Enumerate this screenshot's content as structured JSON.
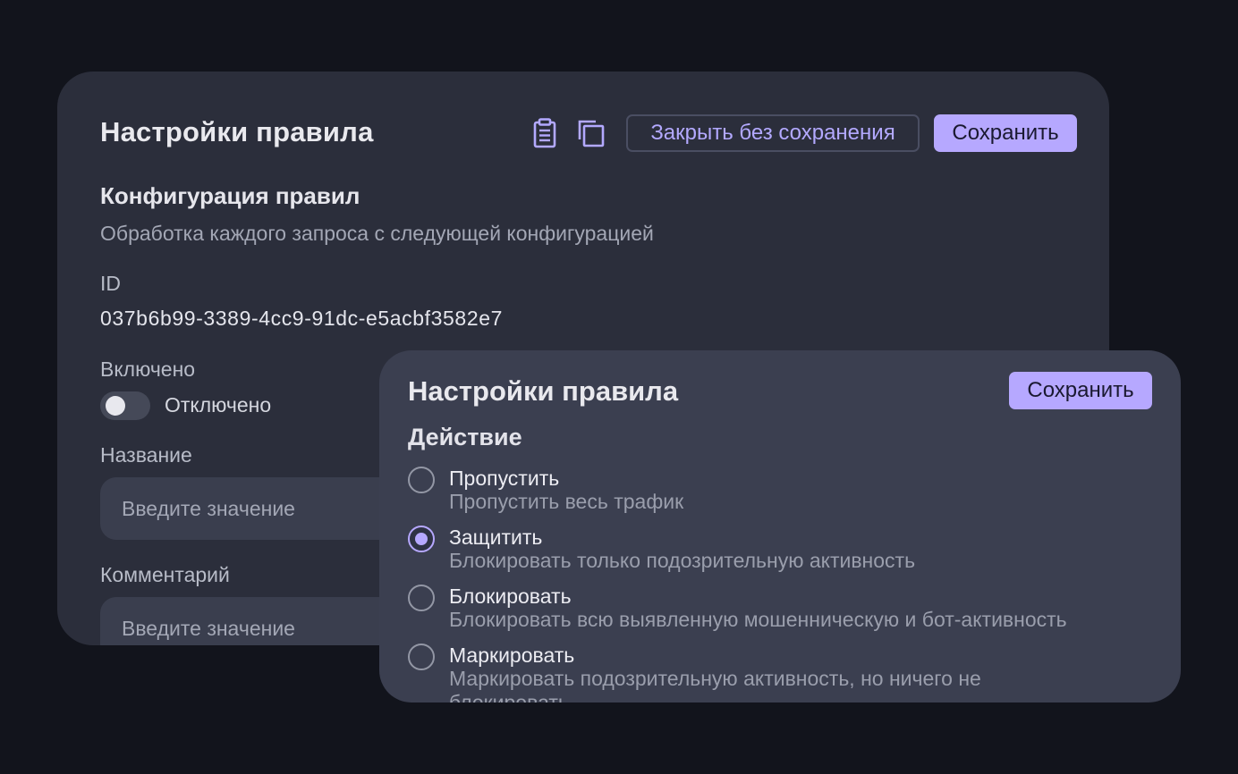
{
  "back_panel": {
    "title": "Настройки правила",
    "icons": [
      "clipboard-icon",
      "copy-icon"
    ],
    "close_button": "Закрыть без сохранения",
    "save_button": "Сохранить",
    "section_title": "Конфигурация правил",
    "section_subtitle": "Обработка каждого запроса с следующей конфигурацией",
    "id_label": "ID",
    "id_value": "037b6b99-3389-4cc9-91dc-e5acbf3582e7",
    "enabled_label": "Включено",
    "toggle_state_text": "Отключено",
    "toggle_on": false,
    "name_label": "Название",
    "name_placeholder": "Введите значение",
    "comment_label": "Комментарий",
    "comment_placeholder": "Введите значение"
  },
  "front_panel": {
    "title": "Настройки правила",
    "save_button": "Сохранить",
    "action_title": "Действие",
    "options": [
      {
        "label": "Пропустить",
        "description": "Пропустить весь трафик",
        "selected": false
      },
      {
        "label": "Защитить",
        "description": "Блокировать только подозрительную активность",
        "selected": true
      },
      {
        "label": "Блокировать",
        "description": "Блокировать всю выявленную мошенническую и бот-активность",
        "selected": false
      },
      {
        "label": "Маркировать",
        "description": "Маркировать подозрительную активность, но ничего не блокировать",
        "selected": false
      }
    ]
  },
  "colors": {
    "background": "#12141c",
    "back_panel": "#2b2e3b",
    "front_panel": "#3b3f50",
    "accent": "#b6a8ff"
  }
}
